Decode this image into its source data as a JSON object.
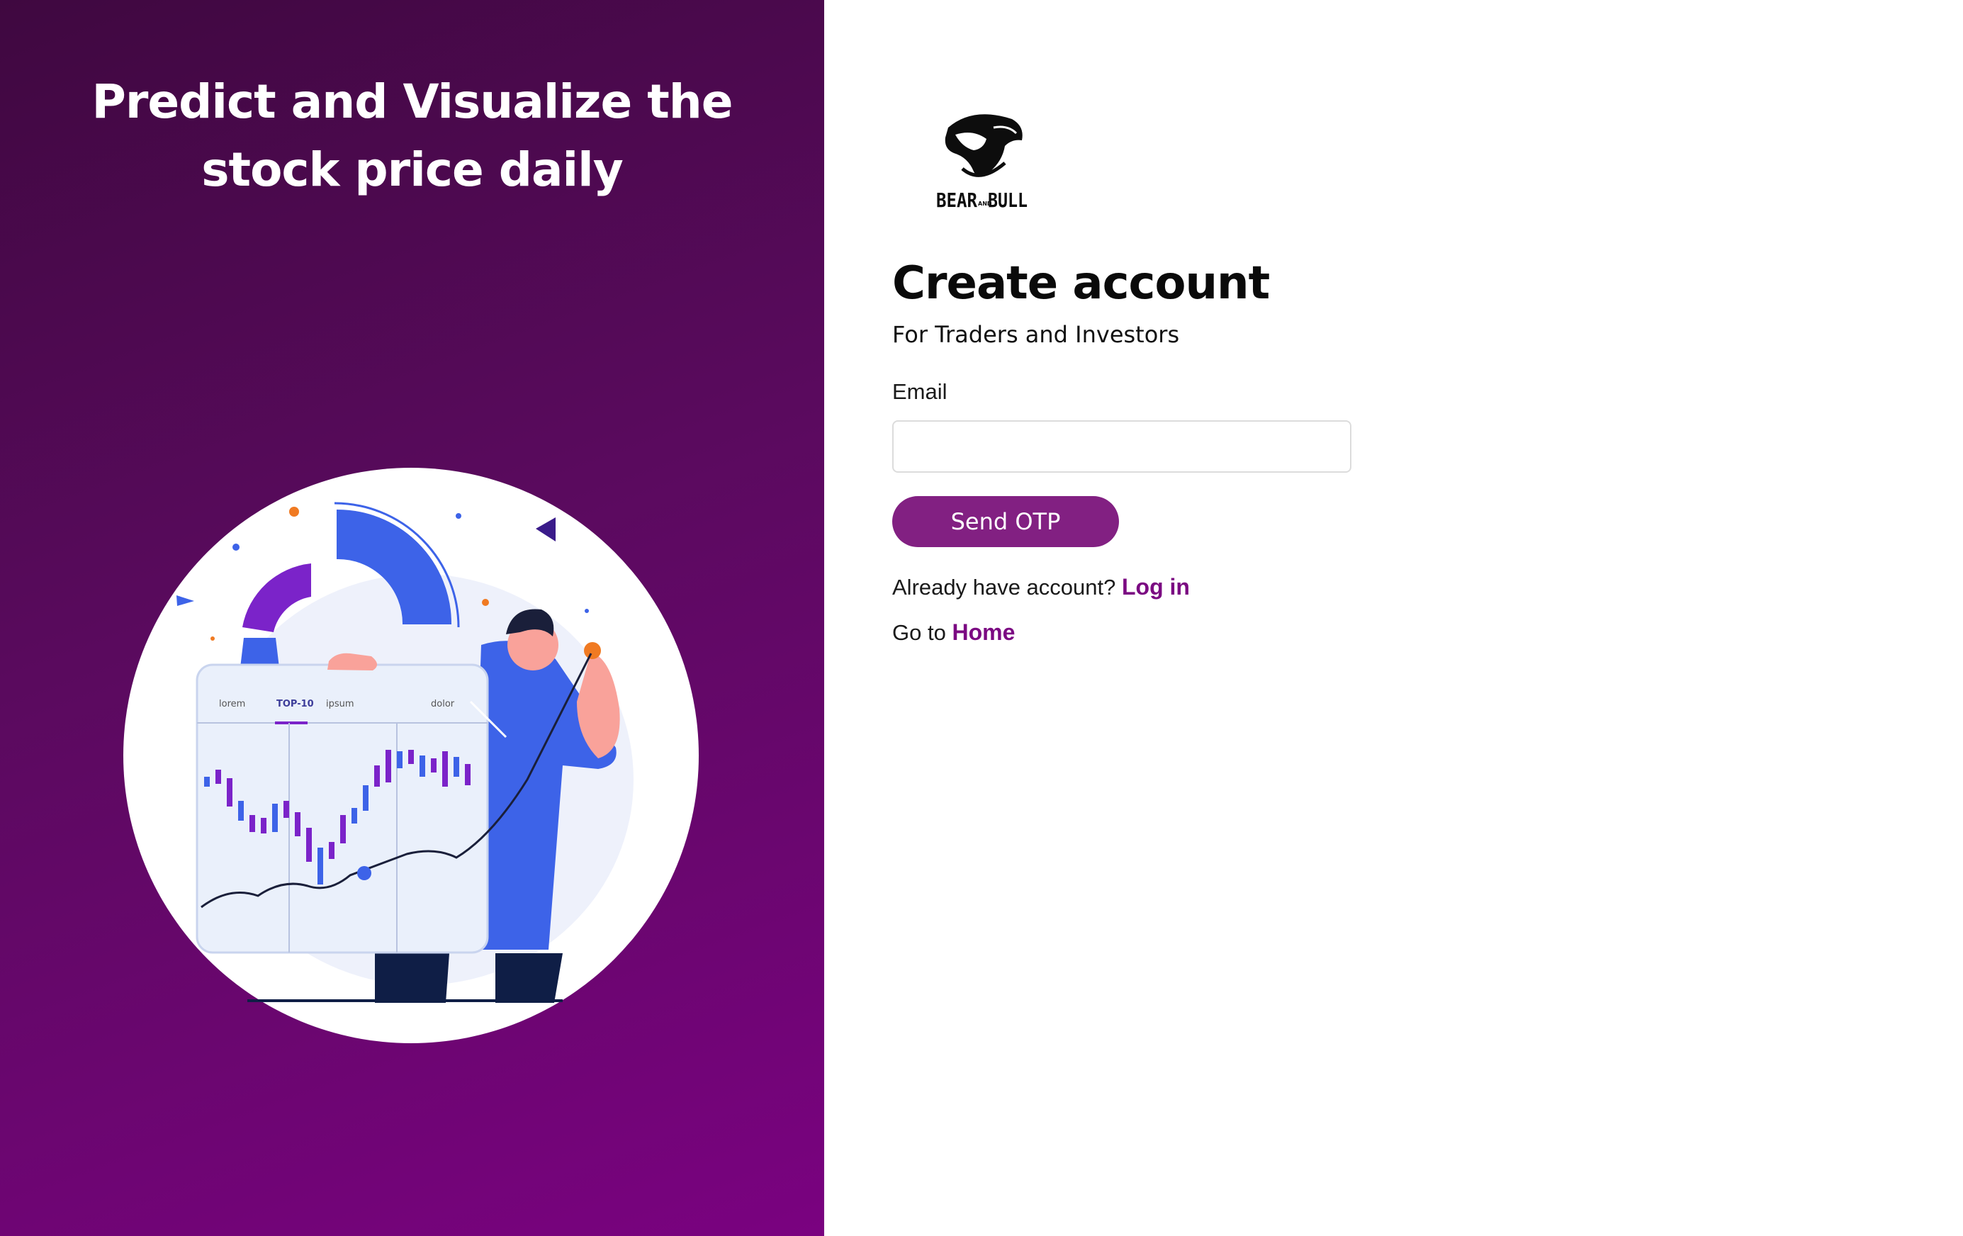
{
  "hero": {
    "title_line1": "Predict and Visualize the",
    "title_line2": "stock price daily",
    "chart_tabs": [
      "lorem",
      "TOP-10",
      "ipsum",
      "dolor"
    ]
  },
  "brand": {
    "logo_text_left": "BEAR",
    "logo_text_mid": "AND",
    "logo_text_right": "BULL"
  },
  "form": {
    "title": "Create account",
    "subtitle": "For Traders and Investors",
    "email_label": "Email",
    "email_value": "",
    "email_placeholder": "",
    "submit_label": "Send OTP"
  },
  "footer_links": {
    "login_prompt": "Already have account?",
    "login_label": "Log in",
    "home_prompt": "Go to",
    "home_label": "Home"
  },
  "colors": {
    "accent": "#822082",
    "link": "#7b0a82",
    "panel_gradient_start": "#3f0840",
    "panel_gradient_end": "#7a0280"
  }
}
